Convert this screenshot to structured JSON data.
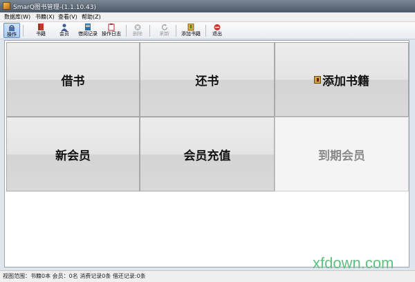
{
  "window": {
    "title": "SmarQ图书管理-(1.1.10.43)"
  },
  "menu": [
    {
      "label": "数据库(W)"
    },
    {
      "label": "书籍(X)"
    },
    {
      "label": "查看(V)"
    },
    {
      "label": "帮助(Z)"
    }
  ],
  "toolbar": {
    "operate": "操作",
    "books": "书籍",
    "member": "会员",
    "borrow_records": "借阅记录",
    "operation_log": "操作日志",
    "delete": "删除",
    "refresh": "刷新",
    "add_book": "添加书籍",
    "exit": "退出"
  },
  "tiles": {
    "borrow": "借书",
    "return": "还书",
    "add_book": "添加书籍",
    "new_member": "新会员",
    "recharge": "会员充值",
    "expired": "到期会员"
  },
  "status": {
    "text": "视图范围：书籍0本 会员：0名 消费记录0条 借还记录:0条"
  },
  "watermark": "xfdown.com",
  "colors": {
    "title_bar": "#5e6a78",
    "active_tool": "#a9cbee",
    "watermark": "#5cc27e"
  }
}
